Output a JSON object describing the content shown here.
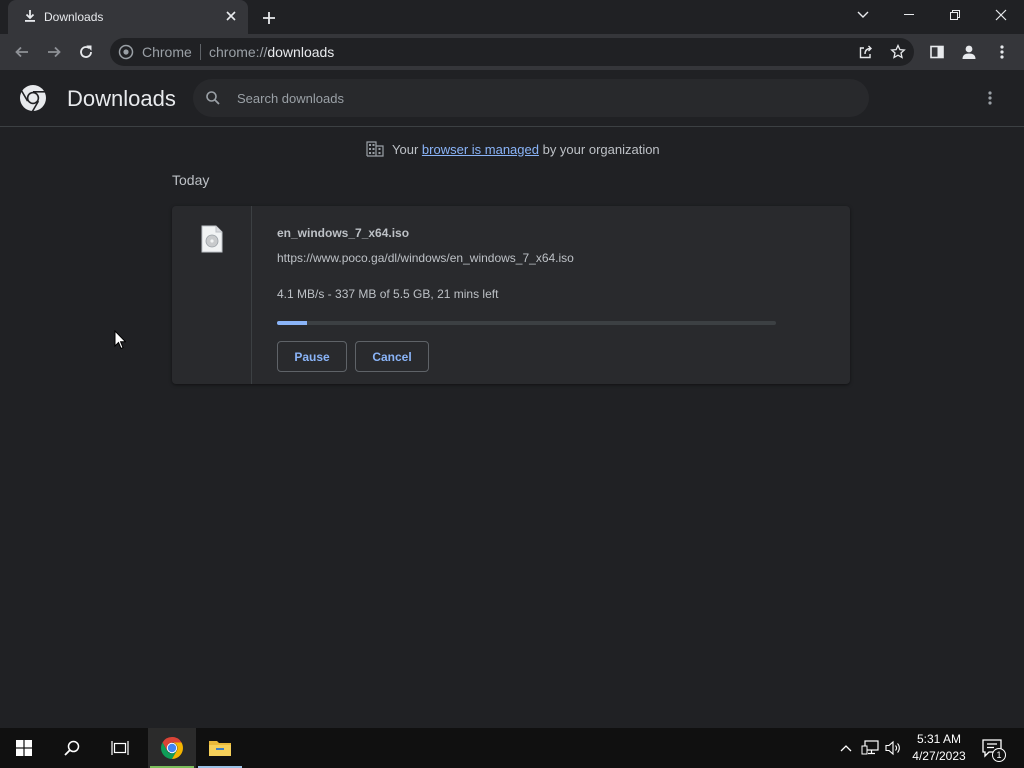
{
  "window": {
    "tab_title": "Downloads",
    "tab_icon": "download-icon"
  },
  "toolbar": {
    "site_chip": "Chrome",
    "url_scheme": "chrome://",
    "url_host": "downloads"
  },
  "header": {
    "title": "Downloads",
    "search_placeholder": "Search downloads"
  },
  "managed": {
    "prefix": "Your",
    "link": "browser is managed",
    "suffix": "by your organization"
  },
  "section": {
    "label": "Today"
  },
  "download": {
    "filename": "en_windows_7_x64.iso",
    "url": "https://www.poco.ga/dl/windows/en_windows_7_x64.iso",
    "status": "4.1 MB/s - 337 MB of 5.5 GB, 21 mins left",
    "progress_fraction": 0.061,
    "pause_label": "Pause",
    "cancel_label": "Cancel"
  },
  "taskbar": {
    "time": "5:31 AM",
    "date": "4/27/2023",
    "notification_count": "1"
  },
  "colors": {
    "accent": "#8ab4f8",
    "background": "#202124",
    "card": "#292a2d"
  }
}
